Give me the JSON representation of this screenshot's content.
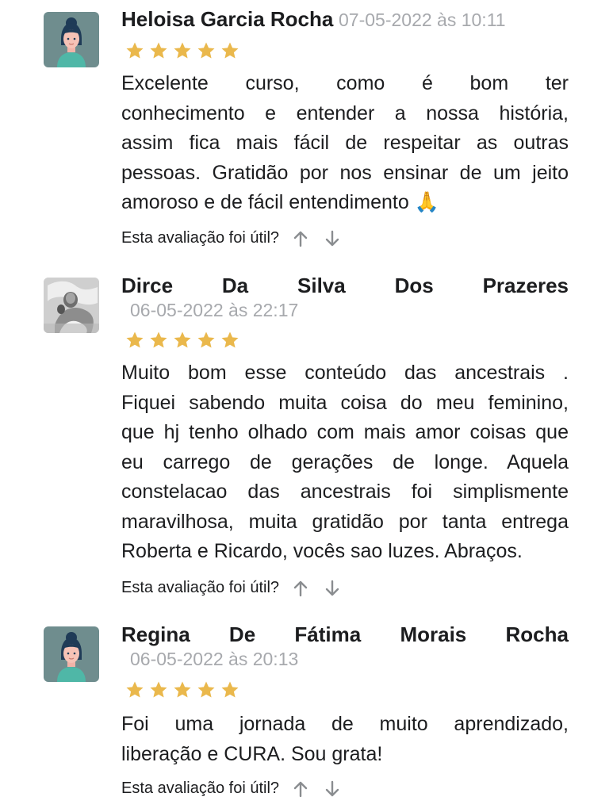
{
  "colors": {
    "star": "#eab84c",
    "date": "#a7a9ad",
    "text": "#1c1d1f",
    "vote": "#8a8d90"
  },
  "helpful_prompt": "Esta avaliação foi útil?",
  "reviews": [
    {
      "name": "Heloisa Garcia Rocha",
      "name_words": [
        "Heloisa",
        "Garcia",
        "Rocha"
      ],
      "date": "07-05-2022 às 10:11",
      "rating": 5,
      "avatar": "woman-avatar-icon",
      "lines": [
        "Excelente curso, como é bom ter",
        "conhecimento e entender a nossa história,",
        "assim fica mais fácil de respeitar as outras",
        "pessoas. Gratidão por nos ensinar de um jeito",
        "amoroso e de fácil entendimento 🙏"
      ]
    },
    {
      "name": "Dirce Da Silva Dos Prazeres",
      "name_words": [
        "Dirce",
        "Da",
        "Silva",
        "Dos",
        "Prazeres"
      ],
      "date": "06-05-2022 às 22:17",
      "rating": 5,
      "avatar": "photo-avatar",
      "lines": [
        "Muito bom esse conteúdo das ancestrais .",
        "Fiquei sabendo muita coisa do meu feminino,",
        "que hj tenho olhado com mais amor coisas que",
        "eu carrego de gerações de longe. Aquela",
        "constelacao das ancestrais foi simplismente",
        "maravilhosa, muita gratidão por tanta entrega",
        "Roberta e Ricardo, vocês sao luzes. Abraços."
      ]
    },
    {
      "name": "Regina De Fátima Morais Rocha",
      "name_words": [
        "Regina",
        "De",
        "Fátima",
        "Morais",
        "Rocha"
      ],
      "date": "06-05-2022 às 20:13",
      "rating": 5,
      "avatar": "woman-avatar-icon",
      "lines": [
        "Foi uma jornada de muito aprendizado,",
        "liberação e CURA. Sou grata!"
      ]
    }
  ]
}
